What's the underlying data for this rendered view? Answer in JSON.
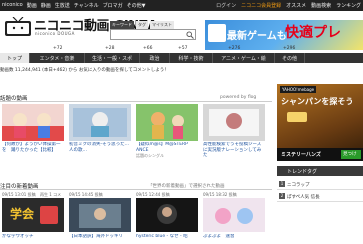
{
  "topbar": {
    "left": [
      "niconico",
      "動画",
      "静画",
      "生放送",
      "チャンネル",
      "ブロマガ",
      "その他▼"
    ],
    "right": [
      "ログイン",
      "ニコニコ会員登録",
      "オススメ",
      "動画検索",
      "ランキング"
    ]
  },
  "header": {
    "logo": "ニコニコ動画:GINZA",
    "logo_sub": "niconico DOUGA",
    "search_tabs": [
      "キーワード",
      "タグ",
      "マイリスト"
    ],
    "search_placeholder": ""
  },
  "ad_banner": {
    "text1": "最新ゲームも",
    "text2": "快適プレ"
  },
  "counts": [
    "+72",
    "+28",
    "+66",
    "+57",
    "+276",
    "+296"
  ],
  "nav": [
    "トップ",
    "エンタメ・音楽",
    "生活・一般・スポ",
    "政治",
    "科学・技術",
    "アニメ・ゲーム・絵",
    "その他"
  ],
  "info_line": "動画数 11,244,941 (本日+462) から お気に入りの動画を探してコメントしよう！",
  "topics": {
    "title": "話題の動画",
    "powered": "powered by flog",
    "videos": [
      {
        "caption": "【何故か】ようかい体操第一を　踊りたかった【比較】",
        "sub": ""
      },
      {
        "caption": "初音ミクの消失-そう思った…人の歌…",
        "sub": ""
      },
      {
        "caption": "【疑似m@s】M@STERP ANCE",
        "sub": "話題のシングル"
      },
      {
        "caption": "高性能検索でうそ投稿ジーズに実況版ナレーションしてみた",
        "sub": ""
      }
    ]
  },
  "new_videos": {
    "title": "注目の新着動画",
    "note": "「世界の新着動画」で選択された動画",
    "videos": [
      {
        "meta": "09/15 13:01 投稿",
        "stat": "再生 1 コメ",
        "caption": "かな学ウオッチ"
      },
      {
        "meta": "09/15 14:45 投稿",
        "stat": "",
        "caption": "【日本語訳】海外ドッキリ"
      },
      {
        "meta": "09/15 12:44 投稿",
        "stat": "",
        "caption": "hysteric blue - なぜ - 昭"
      },
      {
        "meta": "09/15 18:32 投稿",
        "stat": "",
        "caption": "ぷよぷよ　速習"
      }
    ]
  },
  "side_ad": {
    "logo": "YAHOO!mebage",
    "headline": "シャンパンを探そう",
    "footer": "ミステリー八ンズ",
    "cta": "見つけ"
  },
  "trends": {
    "title": "トレンドタグ",
    "items": [
      {
        "num": "1",
        "label": "ニコラップ"
      },
      {
        "num": "2",
        "label": "ぽすぺ人気 信長"
      }
    ]
  }
}
